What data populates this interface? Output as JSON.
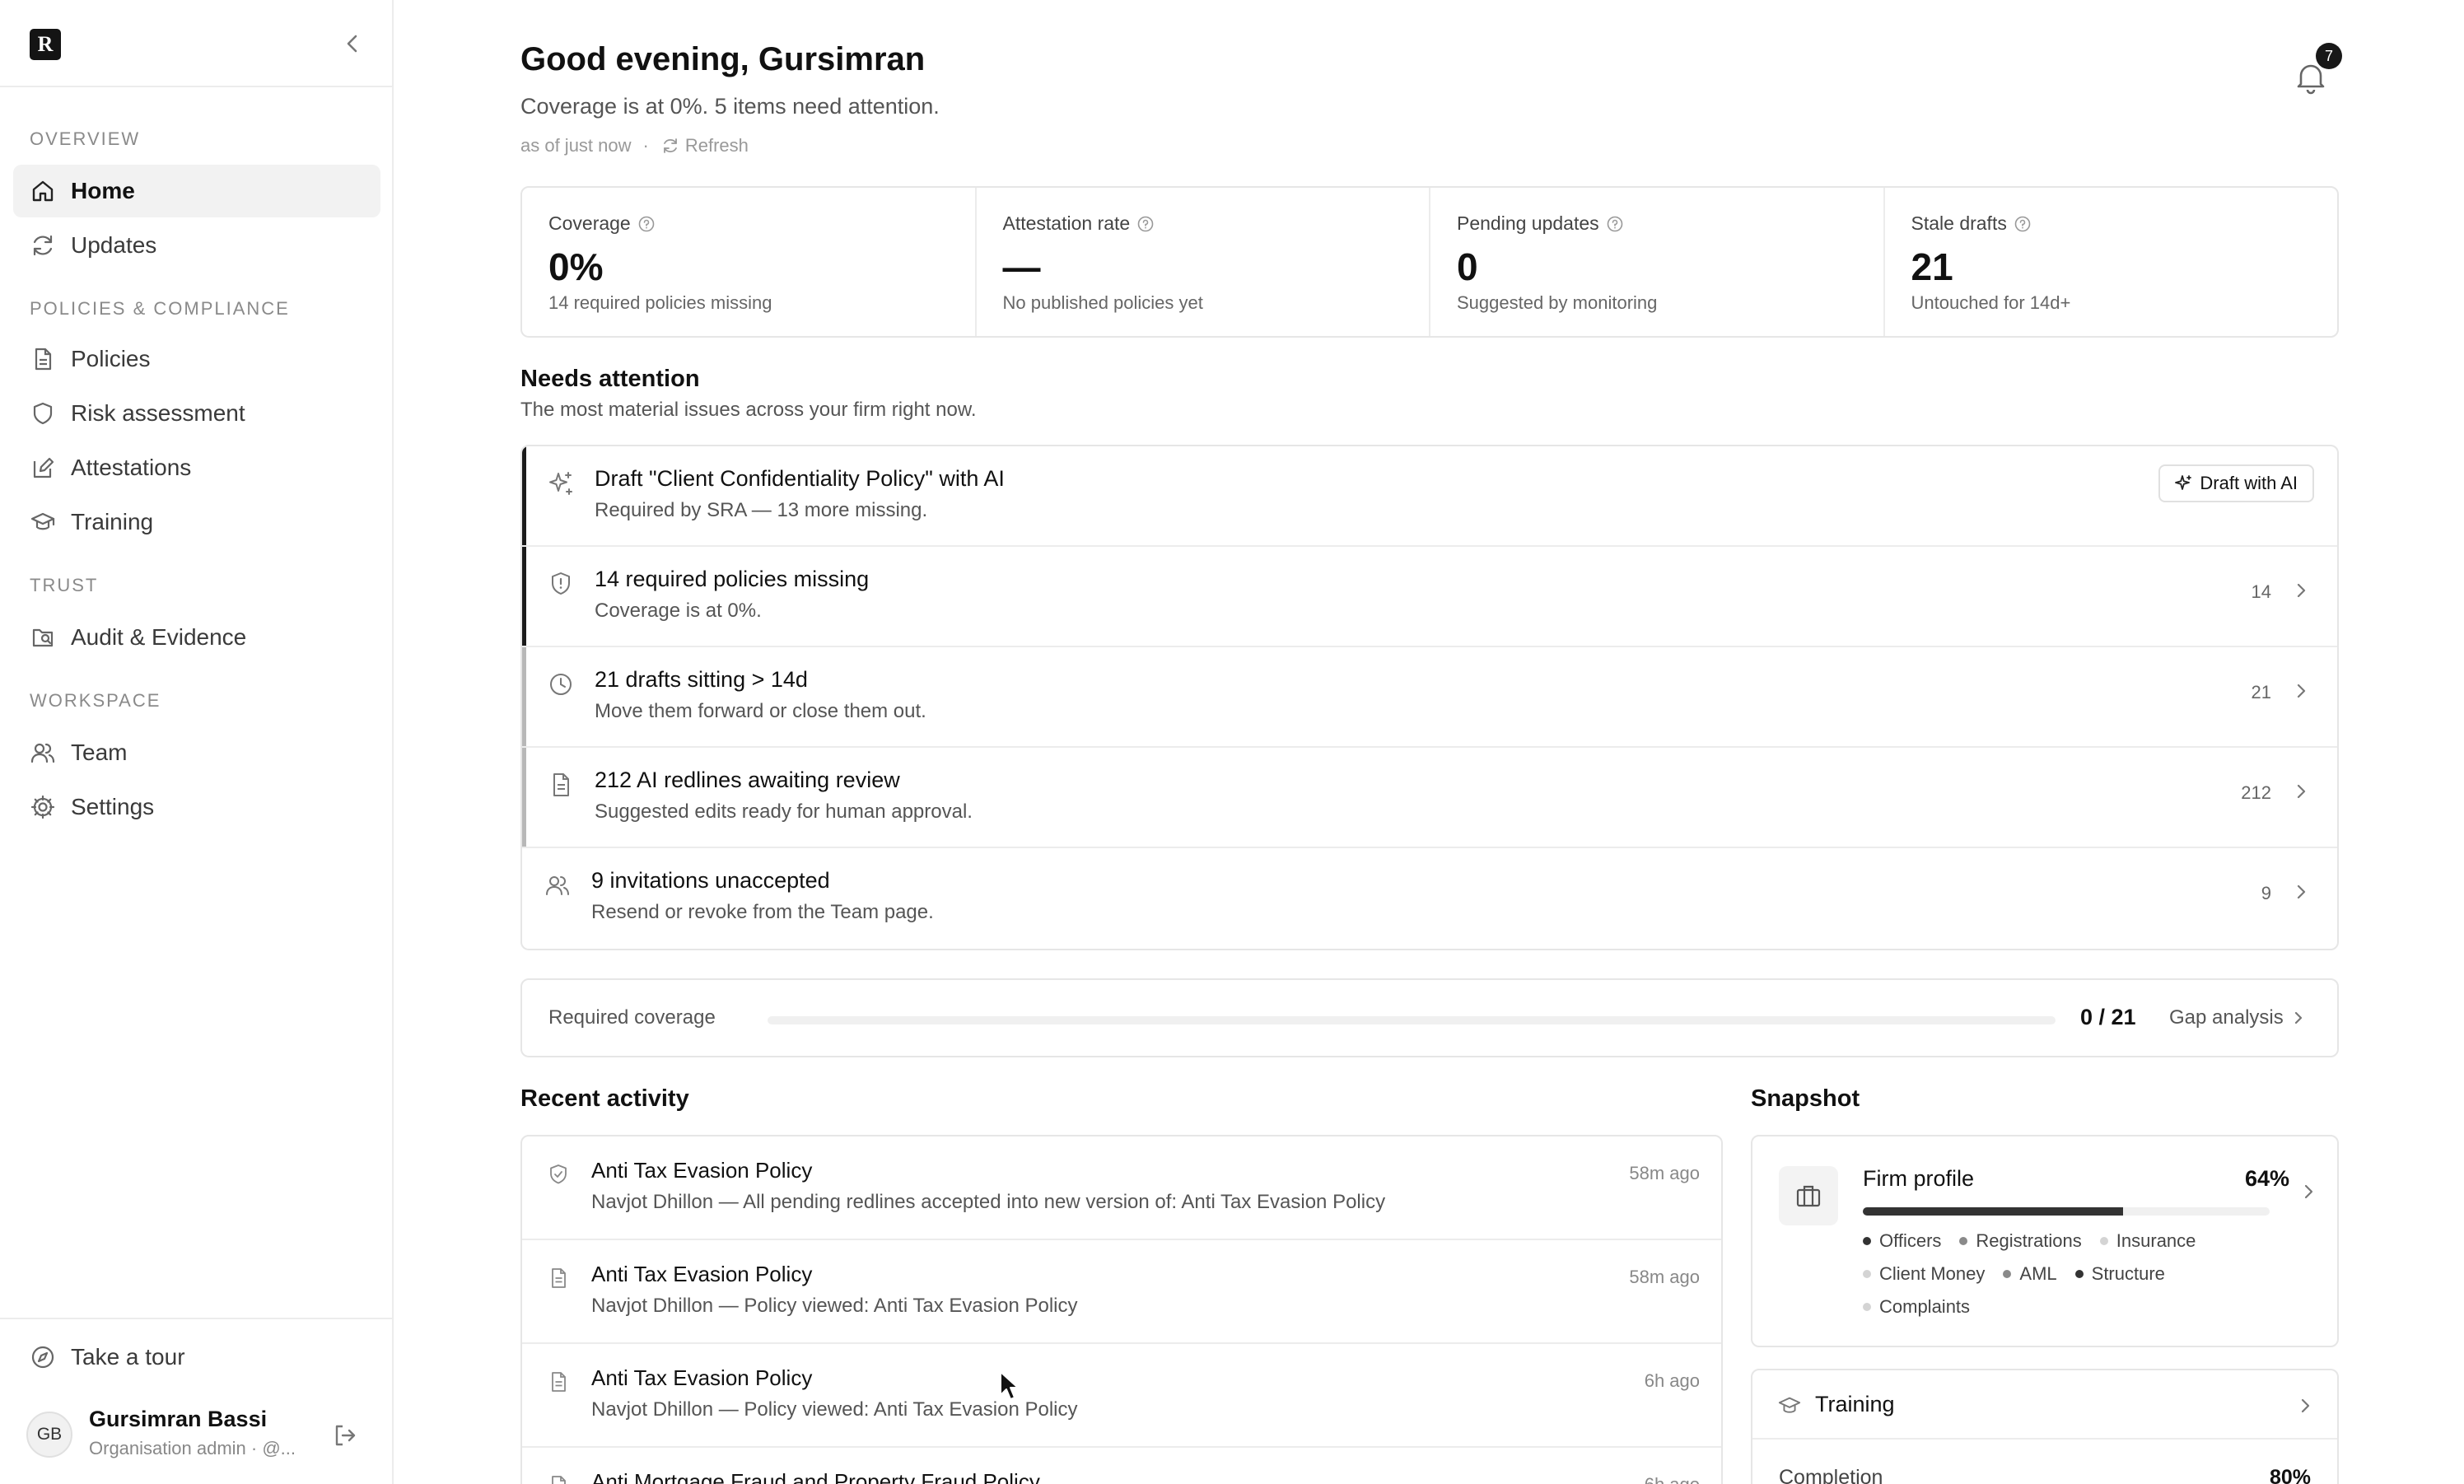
{
  "sidebar": {
    "logo_letter": "R",
    "sections": [
      {
        "label": "OVERVIEW"
      },
      {
        "label": "POLICIES & COMPLIANCE"
      },
      {
        "label": "TRUST"
      },
      {
        "label": "WORKSPACE"
      }
    ],
    "items": [
      {
        "label": "Home",
        "icon": "home-icon",
        "active": true
      },
      {
        "label": "Updates",
        "icon": "refresh-icon"
      },
      {
        "label": "Policies",
        "icon": "document-icon"
      },
      {
        "label": "Risk assessment",
        "icon": "shield-icon"
      },
      {
        "label": "Attestations",
        "icon": "pen-icon"
      },
      {
        "label": "Training",
        "icon": "graduation-cap-icon"
      },
      {
        "label": "Audit & Evidence",
        "icon": "audit-folder-icon"
      },
      {
        "label": "Team",
        "icon": "users-icon"
      },
      {
        "label": "Settings",
        "icon": "gear-icon"
      }
    ],
    "tour_label": "Take a tour",
    "user": {
      "initials": "GB",
      "name": "Gursimran Bassi",
      "role": "Organisation admin · @..."
    }
  },
  "header": {
    "greeting": "Good evening, Gursimran",
    "summary": "Coverage is at 0%. 5 items need attention.",
    "as_of": "as of just now",
    "separator": "·",
    "refresh_label": "Refresh",
    "notification_count": "7"
  },
  "stats": [
    {
      "label": "Coverage",
      "value": "0%",
      "sub": "14 required policies missing"
    },
    {
      "label": "Attestation rate",
      "value": "—",
      "sub": "No published policies yet"
    },
    {
      "label": "Pending updates",
      "value": "0",
      "sub": "Suggested by monitoring"
    },
    {
      "label": "Stale drafts",
      "value": "21",
      "sub": "Untouched for 14d+"
    }
  ],
  "attention": {
    "title": "Needs attention",
    "subtitle": "The most material issues across your firm right now.",
    "items": [
      {
        "title": "Draft \"Client Confidentiality Policy\" with AI",
        "sub": "Required by SRA — 13 more missing.",
        "action": "Draft with AI",
        "icon": "sparkle-icon"
      },
      {
        "title": "14 required policies missing",
        "sub": "Coverage is at 0%.",
        "count": "14",
        "icon": "shield-alert-icon"
      },
      {
        "title": "21 drafts sitting > 14d",
        "sub": "Move them forward or close them out.",
        "count": "21",
        "icon": "clock-icon"
      },
      {
        "title": "212 AI redlines awaiting review",
        "sub": "Suggested edits ready for human approval.",
        "count": "212",
        "icon": "document-icon"
      },
      {
        "title": "9 invitations unaccepted",
        "sub": "Resend or revoke from the Team page.",
        "count": "9",
        "icon": "users-icon"
      }
    ]
  },
  "coverage": {
    "label": "Required coverage",
    "value": "0 / 21",
    "fraction": 0,
    "link": "Gap analysis"
  },
  "activity": {
    "title": "Recent activity",
    "items": [
      {
        "title": "Anti Tax Evasion Policy",
        "sub": "Navjot Dhillon — All pending redlines accepted into new version of: Anti Tax Evasion Policy",
        "time": "58m ago",
        "icon": "shield-check-icon"
      },
      {
        "title": "Anti Tax Evasion Policy",
        "sub": "Navjot Dhillon — Policy viewed: Anti Tax Evasion Policy",
        "time": "58m ago",
        "icon": "document-icon"
      },
      {
        "title": "Anti Tax Evasion Policy",
        "sub": "Navjot Dhillon — Policy viewed: Anti Tax Evasion Policy",
        "time": "6h ago",
        "icon": "document-icon"
      },
      {
        "title": "Anti Mortgage Fraud and Property Fraud Policy",
        "sub": "",
        "time": "6h ago",
        "icon": "document-icon"
      }
    ]
  },
  "snapshot": {
    "title": "Snapshot",
    "firm_profile": {
      "title": "Firm profile",
      "percent": "64%",
      "fraction": 0.64,
      "tags": [
        {
          "label": "Officers",
          "color": "#333333"
        },
        {
          "label": "Registrations",
          "color": "#8a8a8a"
        },
        {
          "label": "Insurance",
          "color": "#d4d4d4"
        },
        {
          "label": "Client Money",
          "color": "#d4d4d4"
        },
        {
          "label": "AML",
          "color": "#8a8a8a"
        },
        {
          "label": "Structure",
          "color": "#333333"
        },
        {
          "label": "Complaints",
          "color": "#d4d4d4"
        }
      ]
    },
    "training": {
      "title": "Training",
      "completion_label": "Completion",
      "completion_value": "80%"
    }
  }
}
